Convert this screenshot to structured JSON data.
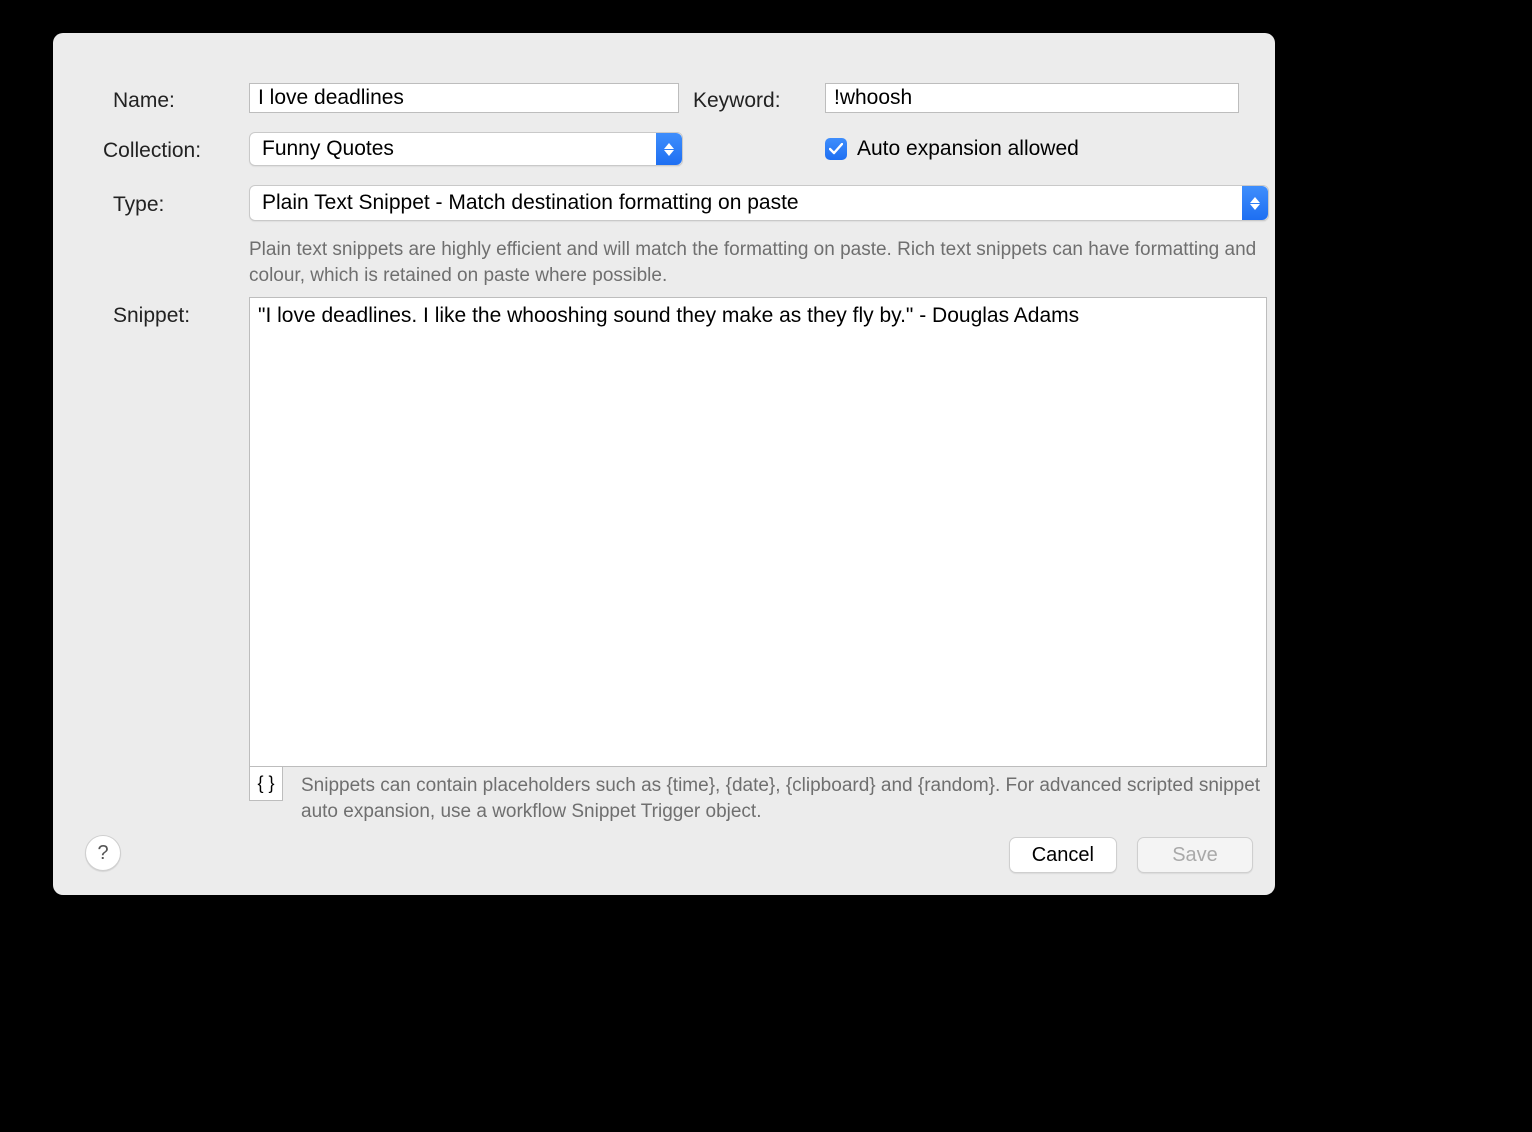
{
  "labels": {
    "name": "Name:",
    "keyword": "Keyword:",
    "collection": "Collection:",
    "type": "Type:",
    "snippet": "Snippet:",
    "auto_expansion": "Auto expansion allowed"
  },
  "fields": {
    "name": "I love deadlines",
    "keyword": "!whoosh",
    "collection": "Funny Quotes",
    "type": "Plain Text Snippet - Match destination formatting on paste",
    "snippet": "\"I love deadlines. I like the whooshing sound they make as they fly by.\" - Douglas Adams",
    "auto_expansion_checked": true
  },
  "help": {
    "type_desc": "Plain text snippets are highly efficient and will match the formatting on paste. Rich text snippets can have formatting and colour, which is retained on paste where possible.",
    "placeholder_desc": "Snippets can contain placeholders such as {time}, {date}, {clipboard} and {random}. For advanced scripted snippet auto expansion, use a workflow Snippet Trigger object.",
    "placeholder_button": "{ }"
  },
  "buttons": {
    "cancel": "Cancel",
    "save": "Save",
    "help": "?"
  }
}
